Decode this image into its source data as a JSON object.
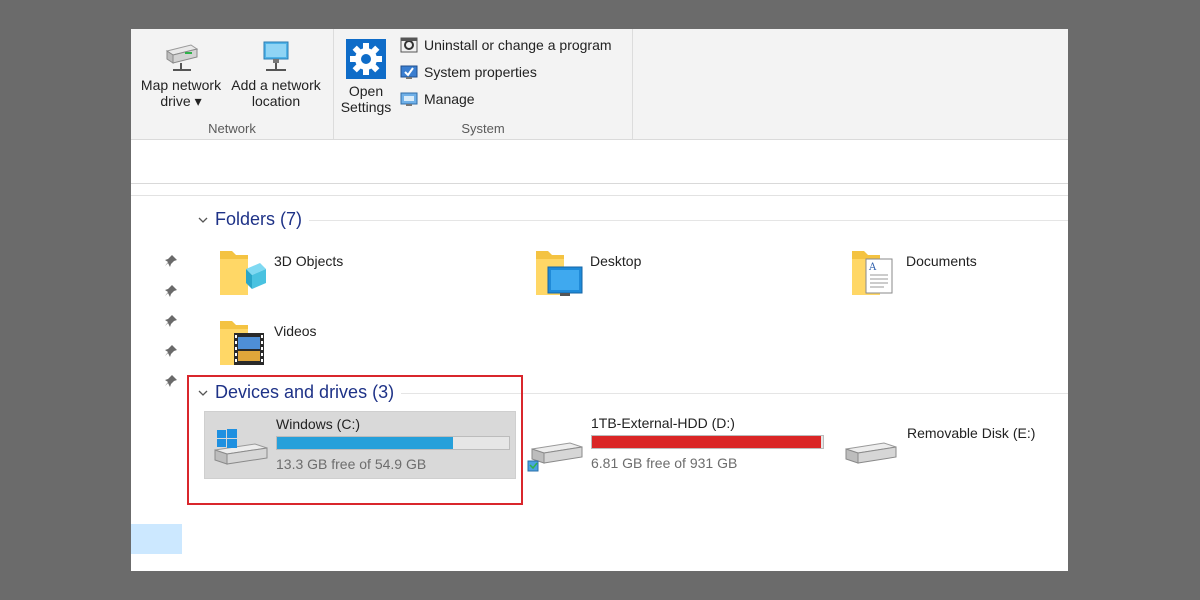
{
  "ribbon": {
    "network": {
      "group_label": "Network",
      "map_drive_line1": "Map network",
      "map_drive_line2": "drive ▾",
      "add_location_line1": "Add a network",
      "add_location_line2": "location"
    },
    "system": {
      "group_label": "System",
      "open_settings_line1": "Open",
      "open_settings_line2": "Settings",
      "uninstall": "Uninstall or change a program",
      "system_properties": "System properties",
      "manage": "Manage"
    }
  },
  "folders": {
    "header": "Folders (7)",
    "items": [
      {
        "name": "3D Objects"
      },
      {
        "name": "Desktop"
      },
      {
        "name": "Documents"
      },
      {
        "name": "Videos"
      }
    ]
  },
  "drives": {
    "header": "Devices and drives (3)",
    "items": [
      {
        "name": "Windows (C:)",
        "free_text": "13.3 GB free of 54.9 GB",
        "used_fraction": 0.758,
        "bar_color": "#26a0da"
      },
      {
        "name": "1TB-External-HDD (D:)",
        "free_text": "6.81 GB free of 931 GB",
        "used_fraction": 0.993,
        "bar_color": "#da2626"
      },
      {
        "name": "Removable Disk (E:)"
      }
    ]
  },
  "colors": {
    "section_header": "#1e3287",
    "highlight": "#d9262c",
    "selection": "#cce8ff"
  }
}
